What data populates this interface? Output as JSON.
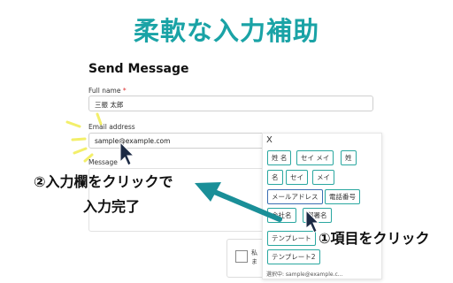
{
  "headline": "柔軟な入力補助",
  "form": {
    "title": "Send Message",
    "fullname_label": "Full name",
    "fullname_required": "*",
    "fullname_value": "三振 太郎",
    "email_label": "Email address",
    "email_value": "sample@example.com",
    "message_label": "Message"
  },
  "checkbox": {
    "line1": "私",
    "line2": "ま"
  },
  "popup": {
    "close_label": "X",
    "question_label": "?",
    "chips": [
      "姓 名",
      "セイ メイ",
      "姓",
      "名",
      "セイ",
      "メイ",
      "メールアドレス",
      "電話番号",
      "会社名",
      "部署名",
      "テンプレート",
      "テンプレート2"
    ],
    "footer": "選択中: sample@example.c..."
  },
  "callouts": {
    "left_line1": "②入力欄をクリックで",
    "left_line2": "入力完了",
    "right": "①項目をクリック"
  },
  "colors": {
    "accent": "#1aa3a6",
    "arrow": "#1a8f98",
    "chip_border": "#2aa7a0",
    "highlight": "#f3ef6a"
  }
}
